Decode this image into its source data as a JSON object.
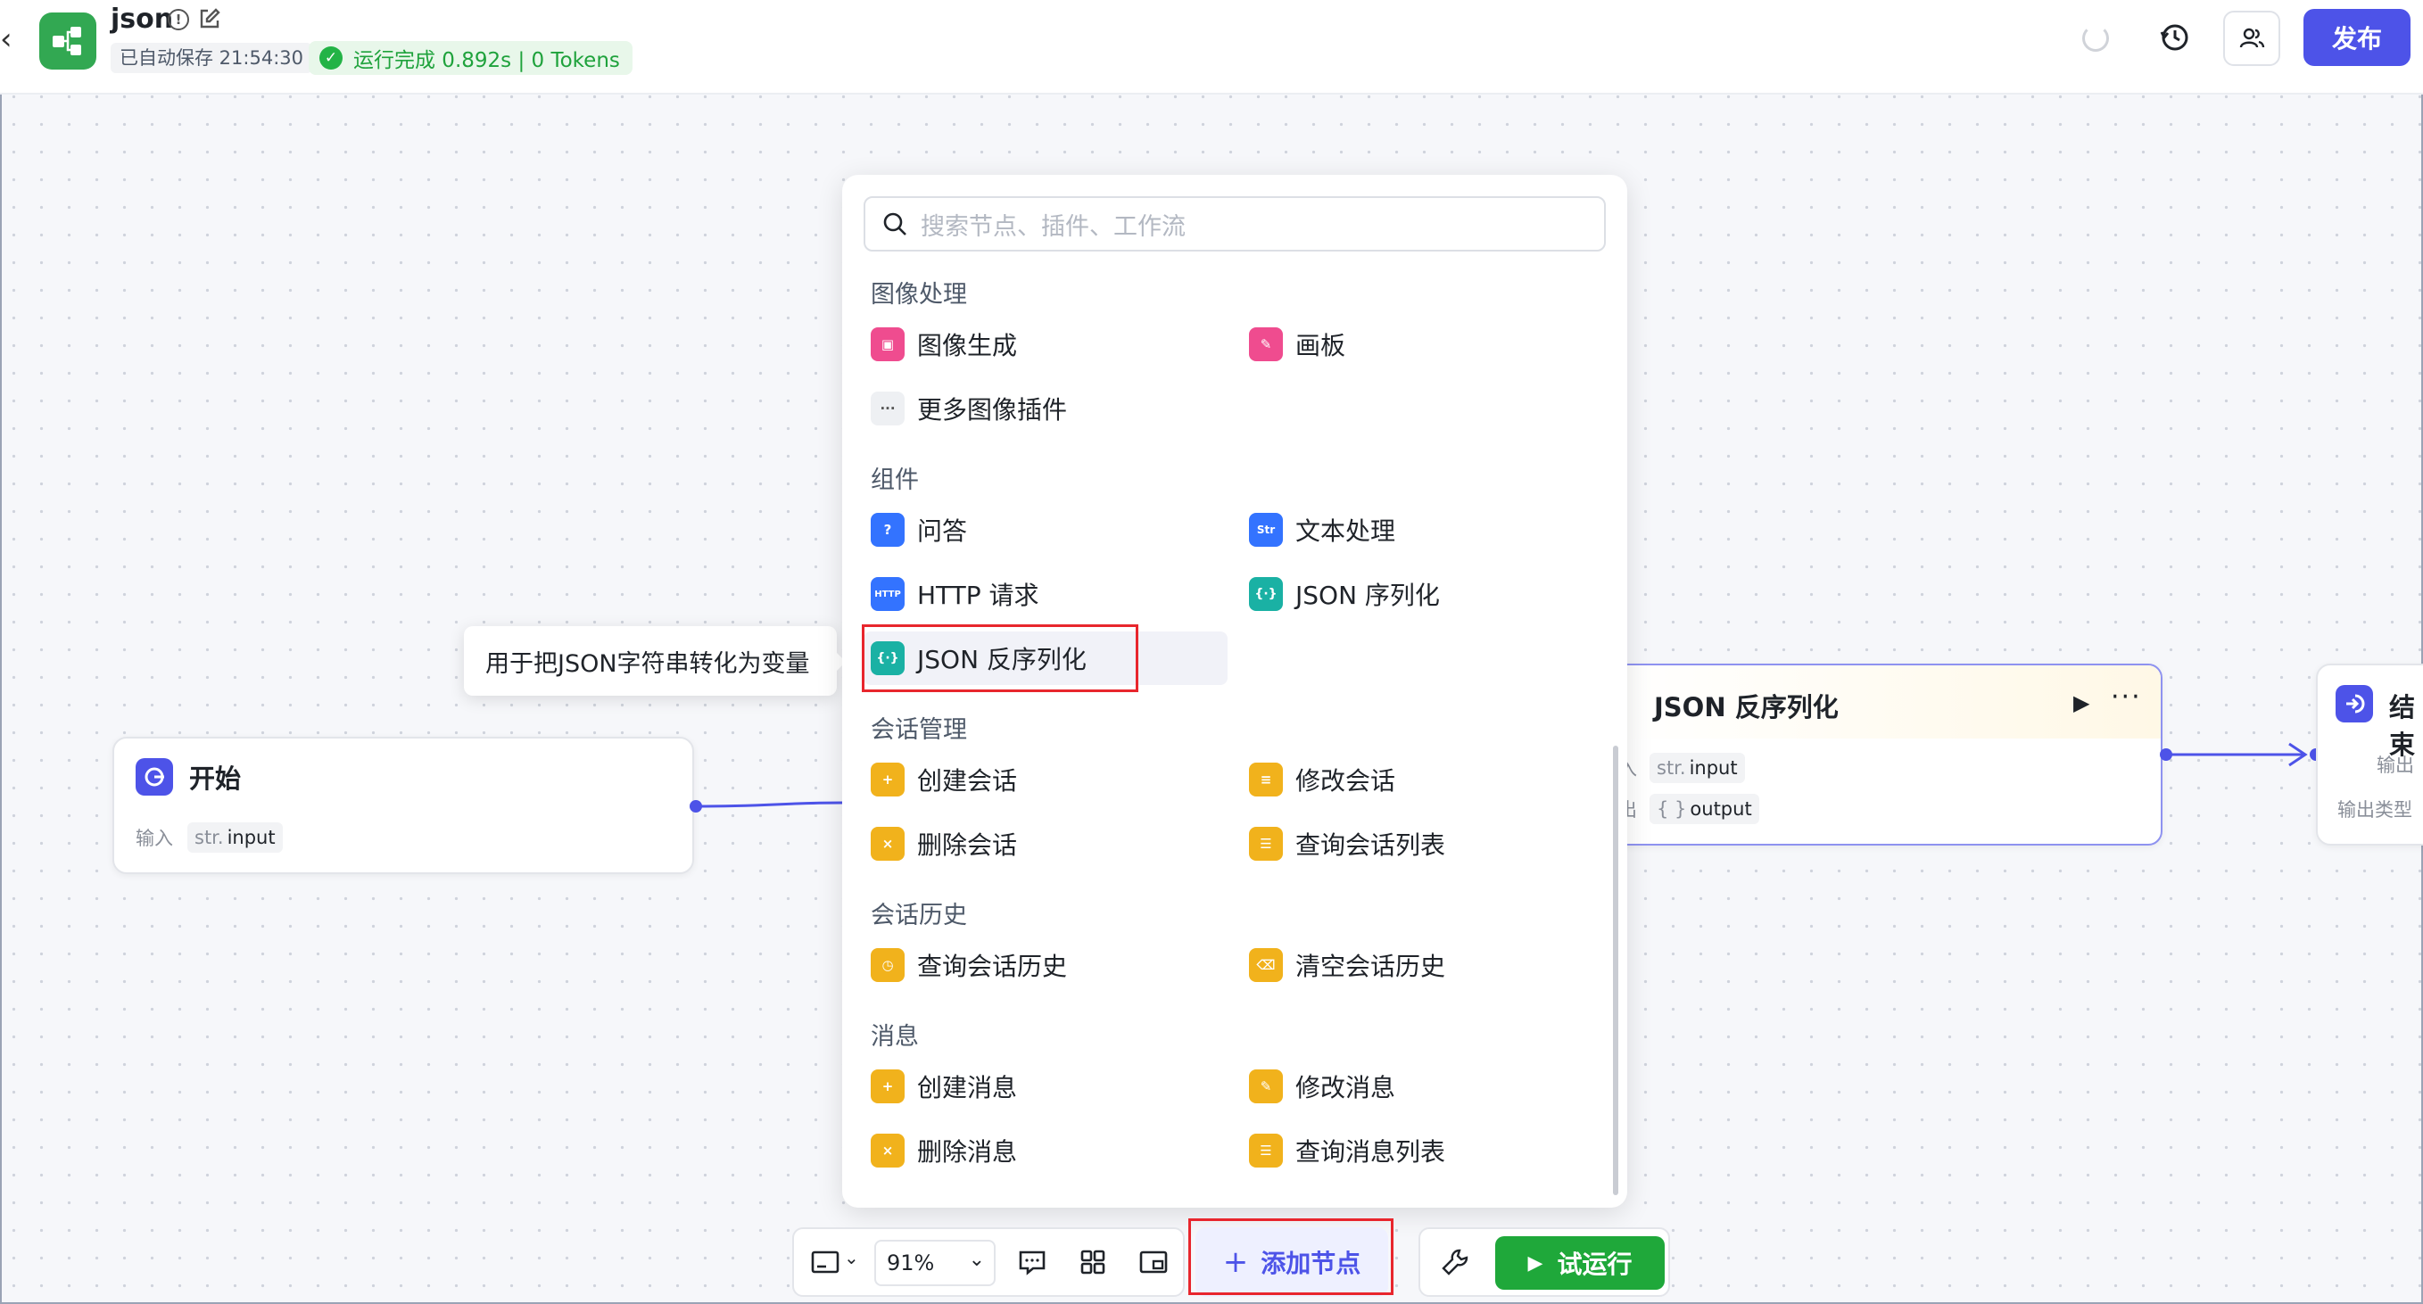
{
  "header": {
    "app_title": "json",
    "autosave": "已自动保存 21:54:30",
    "run_status": "运行完成 0.892s | 0 Tokens",
    "publish_label": "发布"
  },
  "nodes": {
    "start": {
      "title": "开始",
      "input_label": "输入",
      "param_type": "str.",
      "param_name": "input"
    },
    "json": {
      "title": "JSON 反序列化",
      "input_label": "入",
      "input_type": "str.",
      "input_name": "input",
      "output_label": "出",
      "output_type": "{ }",
      "output_name": "output"
    },
    "end": {
      "title": "结束",
      "output_label": "输出",
      "output_type_label": "输出类型"
    }
  },
  "popup": {
    "search_placeholder": "搜索节点、插件、工作流",
    "sections": [
      {
        "title": "图像处理",
        "items": [
          "图像生成",
          "画板",
          "更多图像插件"
        ]
      },
      {
        "title": "组件",
        "items": [
          "问答",
          "文本处理",
          "HTTP 请求",
          "JSON 序列化",
          "JSON 反序列化"
        ]
      },
      {
        "title": "会话管理",
        "items": [
          "创建会话",
          "修改会话",
          "删除会话",
          "查询会话列表"
        ]
      },
      {
        "title": "会话历史",
        "items": [
          "查询会话历史",
          "清空会话历史"
        ]
      },
      {
        "title": "消息",
        "items": [
          "创建消息",
          "修改消息",
          "删除消息",
          "查询消息列表"
        ]
      }
    ],
    "icon_texts": {
      "http": "HTTP",
      "str": "Str",
      "json": "{·}"
    }
  },
  "tooltip": "用于把JSON字符串转化为变量",
  "toolbar": {
    "zoom": "91%",
    "add_node": "添加节点",
    "trial_run": "试运行"
  },
  "colors": {
    "accent": "#4d53e8",
    "success": "#1fa83a",
    "highlight_box": "#e8262d"
  }
}
